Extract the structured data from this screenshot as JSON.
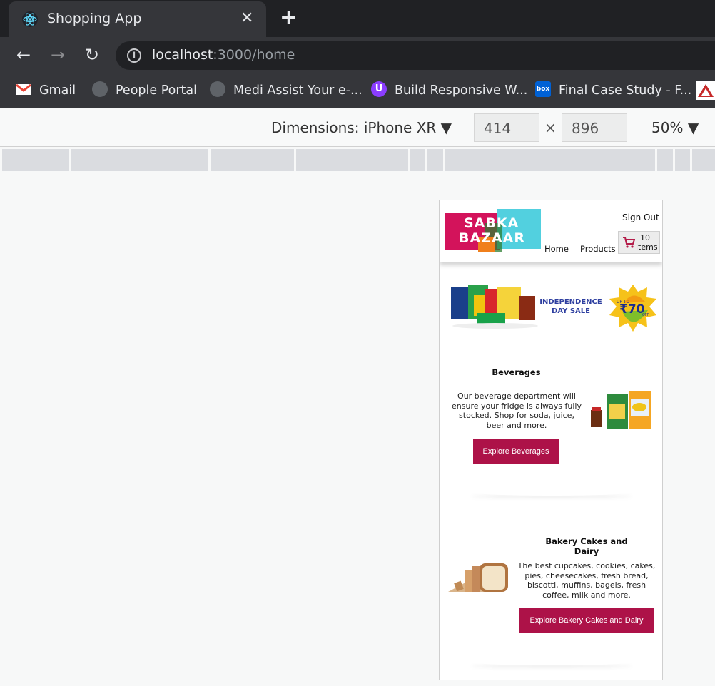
{
  "browser": {
    "tab_title": "Shopping App",
    "tab_icon": "react-icon",
    "url_host": "localhost",
    "url_rest": ":3000/home",
    "bookmarks": [
      {
        "label": "Gmail",
        "icon": "gmail-icon"
      },
      {
        "label": "People Portal",
        "icon": "globe-icon"
      },
      {
        "label": "Medi Assist Your e-...",
        "icon": "globe-icon"
      },
      {
        "label": "Build Responsive W...",
        "icon": "udemy-icon"
      },
      {
        "label": "Final Case Study - F...",
        "icon": "box-icon"
      }
    ]
  },
  "devtools": {
    "dimensions_label": "Dimensions: iPhone XR",
    "width": "414",
    "height": "896",
    "separator": "×",
    "zoom": "50%"
  },
  "app": {
    "logo_line1": "SABKA",
    "logo_line2": "BAZAAR",
    "sign_out": "Sign Out",
    "nav_home": "Home",
    "nav_products": "Products",
    "cart_count": "10",
    "cart_items_label": "items",
    "banner_line1": "INDEPENDENCE",
    "banner_line2": "DAY SALE",
    "banner_upto": "UP TO",
    "banner_percent": "₹70",
    "banner_off": "OFF",
    "categories": [
      {
        "title": "Beverages",
        "description": "Our beverage department will ensure your fridge is always fully stocked. Shop for soda, juice, beer and more.",
        "button": "Explore Beverages"
      },
      {
        "title": "Bakery Cakes and Dairy",
        "description": "The best cupcakes, cookies, cakes, pies, cheesecakes, fresh bread, biscotti, muffins, bagels, fresh coffee, milk and more.",
        "button": "Explore Bakery Cakes and Dairy"
      }
    ],
    "colors": {
      "primary_button": "#ad1248",
      "logo_pink": "#d3135b",
      "logo_cyan": "#52d0df"
    }
  }
}
